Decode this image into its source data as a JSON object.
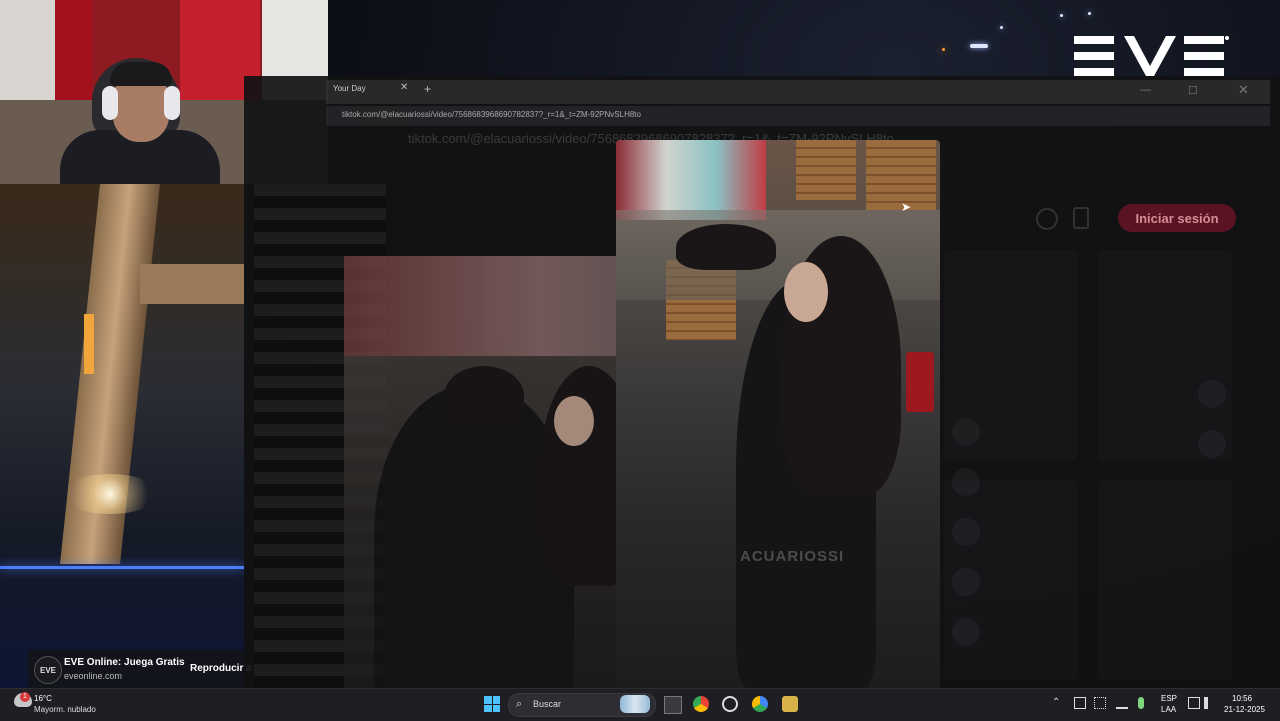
{
  "brand": {
    "logo_text": "EVE",
    "accent": "#ffffff"
  },
  "browser": {
    "tab_title": "Your Day",
    "url": "tiktok.com/@elacuariossi/video/7568683968690782837?_r=1&_t=ZM-92PNvSLH8to",
    "url_ghost": "tiktok.com/@elacuariossi/video/7568683968690782837?_r=1&_t=ZM-92PNvSLH8to",
    "min_icon": "minimize-icon",
    "max_icon": "maximize-icon",
    "close_icon": "close-icon"
  },
  "tiktok": {
    "login_label": "Iniciar sesión",
    "watermark": "ACUARIOSSI"
  },
  "ad": {
    "logo": "EVE",
    "title": "EVE Online: Juega Gratis",
    "url": "eveonline.com",
    "cta": "Reproducir a"
  },
  "taskbar": {
    "weather_temp": "16°C",
    "weather_desc": "Mayorm. nublado",
    "weather_badge": "1",
    "search_placeholder": "Buscar",
    "lang_top": "ESP",
    "lang_bottom": "LAA",
    "time": "10:56",
    "date": "21-12-2025"
  },
  "colors": {
    "taskbar_bg": "#1f1f23",
    "start_blue": "#4cc2ff",
    "login_red": "#fe2c55"
  }
}
